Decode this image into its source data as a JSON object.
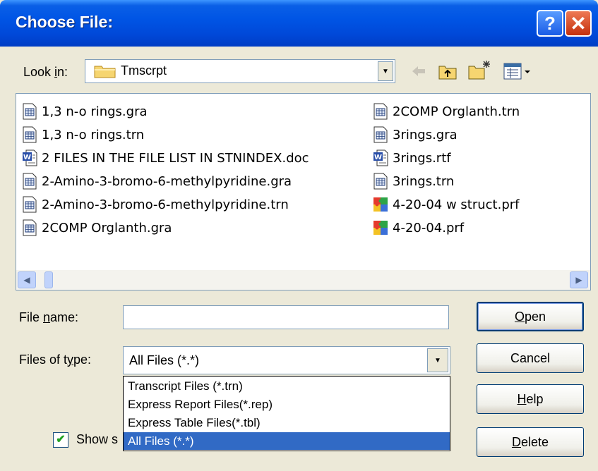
{
  "window": {
    "title": "Choose File:"
  },
  "title_buttons": {
    "help": "?",
    "close": "✕"
  },
  "look_in": {
    "label_pre": "Look ",
    "label_key": "i",
    "label_post": "n:",
    "value": "Tmscrpt"
  },
  "files_left": [
    {
      "name": "1,3 n-o rings.gra",
      "icon": "document-grid-icon"
    },
    {
      "name": "1,3 n-o rings.trn",
      "icon": "document-grid-icon"
    },
    {
      "name": "2 FILES IN THE FILE LIST IN STNINDEX.doc",
      "icon": "word-document-icon"
    },
    {
      "name": "2-Amino-3-bromo-6-methylpyridine.gra",
      "icon": "document-grid-icon"
    },
    {
      "name": "2-Amino-3-bromo-6-methylpyridine.trn",
      "icon": "document-grid-icon"
    },
    {
      "name": "2COMP Orglanth.gra",
      "icon": "document-grid-icon"
    }
  ],
  "files_right": [
    {
      "name": "2COMP Orglanth.trn",
      "icon": "document-grid-icon"
    },
    {
      "name": "3rings.gra",
      "icon": "document-grid-icon"
    },
    {
      "name": "3rings.rtf",
      "icon": "word-document-icon"
    },
    {
      "name": "3rings.trn",
      "icon": "document-grid-icon"
    },
    {
      "name": "4-20-04 w struct.prf",
      "icon": "puzzle-icon"
    },
    {
      "name": "4-20-04.prf",
      "icon": "puzzle-icon"
    }
  ],
  "file_name": {
    "label_pre": "File ",
    "label_key": "n",
    "label_post": "ame:",
    "value": ""
  },
  "files_of_type": {
    "label_pre": "Files of t",
    "label_key": "y",
    "label_post": "pe:",
    "value": "All Files (*.*)",
    "options": [
      "Transcript Files (*.trn)",
      "Express Report Files(*.rep)",
      "Express Table Files(*.tbl)",
      "All Files (*.*)"
    ],
    "selected_index": 3
  },
  "buttons": {
    "open_key": "O",
    "open_rest": "pen",
    "cancel": "Cancel",
    "help_key": "H",
    "help_rest": "elp",
    "delete_key": "D",
    "delete_rest": "elete"
  },
  "show_checkbox": {
    "label": "Show s",
    "checked": true,
    "check_mark": "✔"
  }
}
